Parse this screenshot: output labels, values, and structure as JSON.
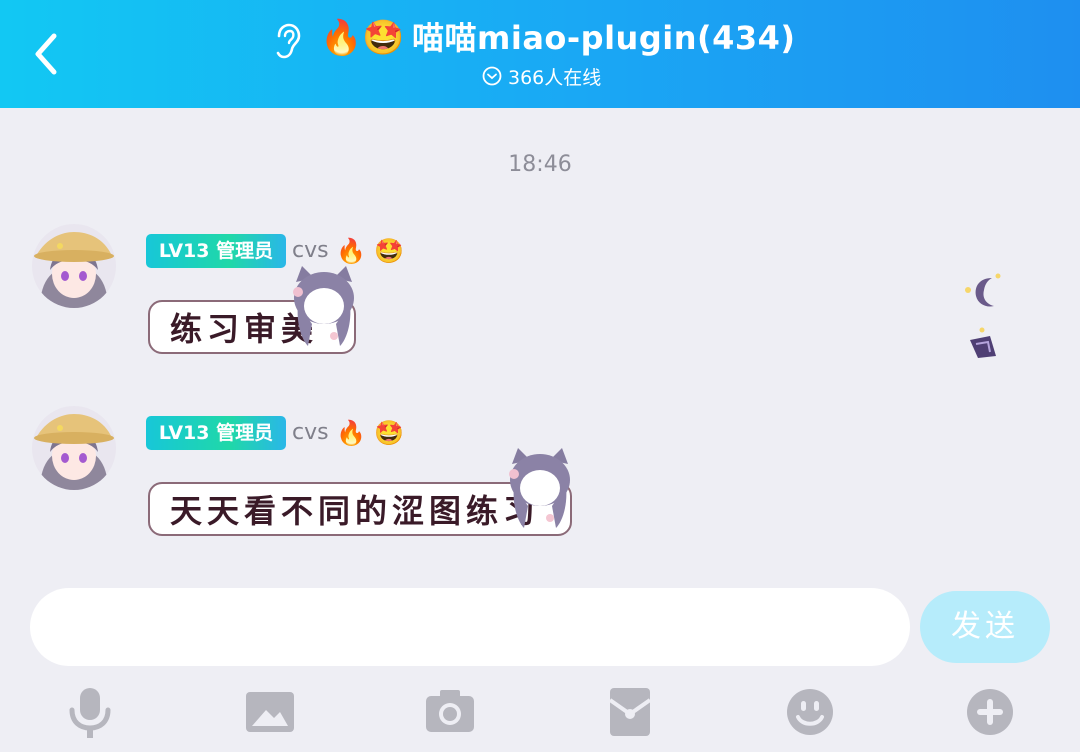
{
  "header": {
    "title": "喵喵miao-plugin(434)",
    "online": "366人在线",
    "title_emojis": [
      "🔥",
      "🤩"
    ]
  },
  "chat": {
    "timestamp": "18:46",
    "messages": [
      {
        "level": "LV13 管理员",
        "sender": "cvs",
        "badges": [
          "🔥",
          "🤩"
        ],
        "text": "练习审美"
      },
      {
        "level": "LV13 管理员",
        "sender": "cvs",
        "badges": [
          "🔥",
          "🤩"
        ],
        "text": "天天看不同的涩图练习"
      }
    ]
  },
  "composer": {
    "input_value": "",
    "send_label": "发送"
  },
  "toolbar": {
    "icons": [
      "microphone-icon",
      "image-icon",
      "camera-icon",
      "red-packet-icon",
      "emoji-icon",
      "plus-icon"
    ]
  },
  "colors": {
    "header_start": "#12c8f3",
    "header_end": "#1e8ff0",
    "background": "#eeeef4",
    "send_button": "#b6ecfb",
    "icon_gray": "#b6b6be"
  }
}
